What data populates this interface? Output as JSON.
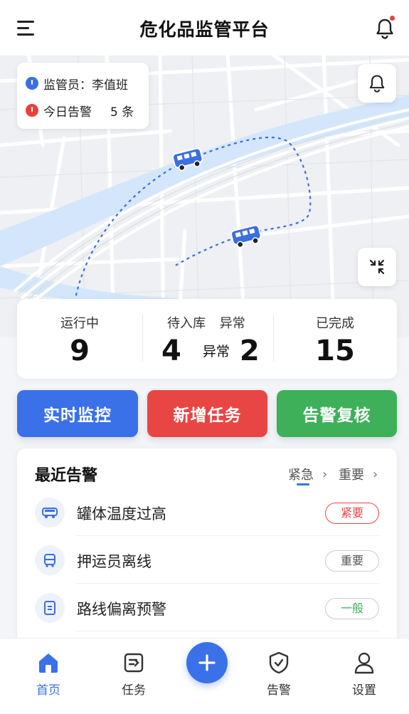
{
  "header": {
    "title": "危化品监管平台"
  },
  "map_panel": {
    "supervisor_label": "监管员：李值班",
    "alerts_today_label": "今日告警",
    "alerts_today_count": "5 条"
  },
  "stats": {
    "running": {
      "label": "运行中",
      "value": "9"
    },
    "pending": {
      "label": "待入库",
      "abnormal_label": "异常",
      "value": "4",
      "abnormal_inline_label": "异常",
      "abnormal_value": "2"
    },
    "completed": {
      "label": "已完成",
      "value": "15"
    }
  },
  "actions": {
    "monitor": "实时监控",
    "new_task": "新增任务",
    "review": "告警复核"
  },
  "alerts": {
    "title": "最近告警",
    "filters": [
      {
        "label": "紧急",
        "active": true
      },
      {
        "label": "重要",
        "active": false
      }
    ],
    "items": [
      {
        "text": "罐体温度过高",
        "level": "紧要",
        "icon": "tanker-icon"
      },
      {
        "text": "押运员离线",
        "level": "重要",
        "icon": "escort-icon"
      },
      {
        "text": "路线偏离预警",
        "level": "一般",
        "icon": "document-icon"
      }
    ]
  },
  "tabbar": {
    "items": [
      {
        "label": "首页",
        "icon": "home-icon",
        "active": true
      },
      {
        "label": "任务",
        "icon": "task-icon",
        "active": false
      },
      {
        "label": "告警",
        "icon": "shield-icon",
        "active": false
      },
      {
        "label": "设置",
        "icon": "user-icon",
        "active": false
      }
    ]
  },
  "colors": {
    "primary": "#3a71e8",
    "danger": "#e84644",
    "success": "#3eb05a",
    "background": "#f3f5f9"
  }
}
